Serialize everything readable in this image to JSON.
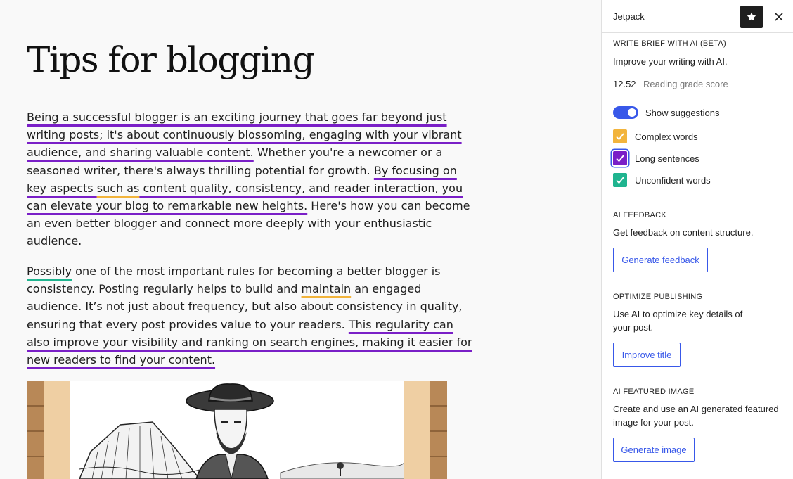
{
  "editor": {
    "title": "Tips for blogging",
    "paragraph1": [
      [
        {
          "t": "Being a successful blogger is an exciting journey that goes far beyond just",
          "h": "long"
        }
      ],
      [
        {
          "t": "writing posts; it's about continuously blossoming, engaging with your vibrant",
          "h": "long"
        }
      ],
      [
        {
          "t": "audience, and sharing valuable content.",
          "h": "long"
        },
        {
          "t": " Whether you're a newcomer or a",
          "h": ""
        }
      ],
      [
        {
          "t": "seasoned writer, there's always thrilling potential for growth. ",
          "h": ""
        },
        {
          "t": "By focusing on",
          "h": "long"
        }
      ],
      [
        {
          "t": "key aspects ",
          "h": "long"
        },
        {
          "t": "such as",
          "h": "complex"
        },
        {
          "t": " content quality, consistency, and reader interaction, you",
          "h": "long"
        }
      ],
      [
        {
          "t": "can elevate your blog to remarkable new heights.",
          "h": "long"
        },
        {
          "t": " Here's how you can become",
          "h": ""
        }
      ],
      [
        {
          "t": "an even better blogger and connect more deeply with your enthusiastic",
          "h": ""
        }
      ],
      [
        {
          "t": "audience.",
          "h": ""
        }
      ]
    ],
    "paragraph2": [
      [
        {
          "t": "Possibly",
          "h": "unconf"
        },
        {
          "t": " one of the most important rules for becoming a better blogger is",
          "h": ""
        }
      ],
      [
        {
          "t": "consistency. Posting regularly helps to build and ",
          "h": ""
        },
        {
          "t": "maintain",
          "h": "complex"
        },
        {
          "t": " an engaged",
          "h": ""
        }
      ],
      [
        {
          "t": "audience. It’s not just about frequency, but also about consistency in quality,",
          "h": ""
        }
      ],
      [
        {
          "t": "ensuring that every post provides value to your readers. ",
          "h": ""
        },
        {
          "t": "This regularity can",
          "h": "long"
        }
      ],
      [
        {
          "t": "also improve your visibility and ranking on search engines, making it easier for",
          "h": "long"
        }
      ],
      [
        {
          "t": "new readers to find your content.",
          "h": "long"
        }
      ]
    ]
  },
  "sidebar": {
    "title": "Jetpack",
    "star_icon": "star-icon",
    "close_icon": "close-icon",
    "write_brief": {
      "heading": "WRITE BRIEF WITH AI (BETA)",
      "description": "Improve your writing with AI.",
      "grade_value": "12.52",
      "grade_label": "Reading grade score",
      "toggle_label": "Show suggestions",
      "toggle_on": true,
      "checkboxes": [
        {
          "label": "Complex words",
          "checked": true,
          "color": "#f2b43c"
        },
        {
          "label": "Long sentences",
          "checked": true,
          "color": "#7a1fc7"
        },
        {
          "label": "Unconfident words",
          "checked": true,
          "color": "#1fb48f"
        }
      ]
    },
    "ai_feedback": {
      "heading": "AI FEEDBACK",
      "description": "Get feedback on content structure.",
      "button": "Generate feedback"
    },
    "optimize_publishing": {
      "heading": "OPTIMIZE PUBLISHING",
      "description_line1": "Use AI to optimize key details of",
      "description_line2": "your post.",
      "button": "Improve title"
    },
    "ai_featured_image": {
      "heading": "AI FEATURED IMAGE",
      "description_line1": "Create and use an AI generated featured",
      "description_line2": "image for your post.",
      "button": "Generate image"
    }
  },
  "colors": {
    "accent": "#3858e9",
    "long_sentences": "#7a1fc7",
    "complex_words": "#f2b43c",
    "unconfident_words": "#1fb48f"
  }
}
